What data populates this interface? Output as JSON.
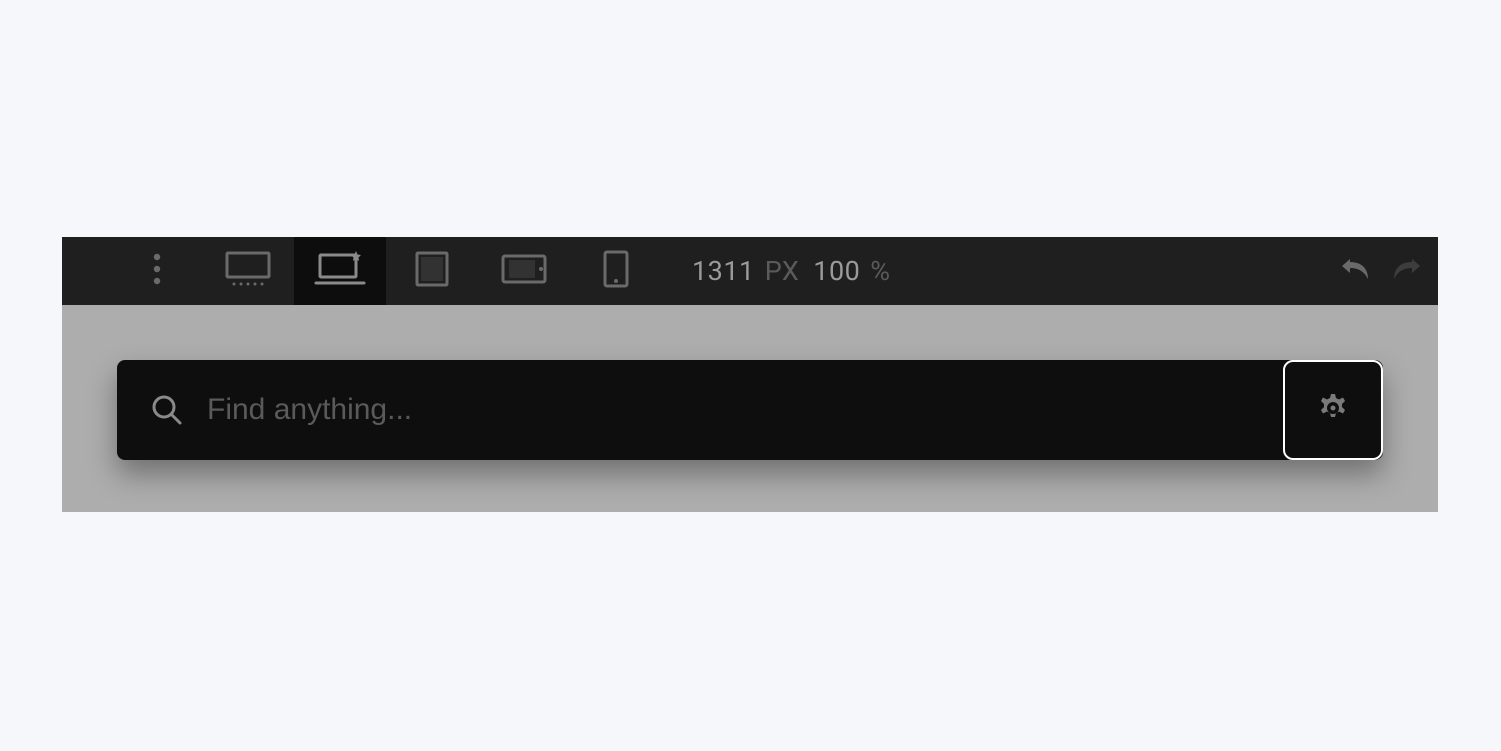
{
  "toolbar": {
    "width_value": "1311",
    "width_unit": "PX",
    "zoom_value": "100",
    "zoom_unit": "%"
  },
  "search": {
    "placeholder": "Find anything..."
  }
}
